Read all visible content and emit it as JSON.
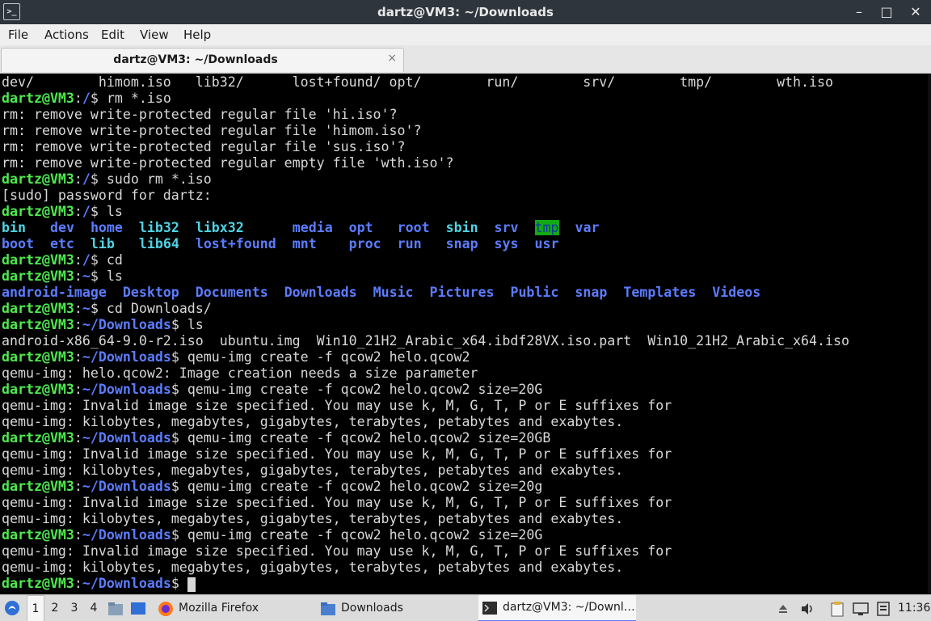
{
  "window": {
    "title": "dartz@VM3: ~/Downloads",
    "icon_text": ">_",
    "controls": {
      "minimize": "–",
      "maximize": "□",
      "close": "✕"
    }
  },
  "menu": [
    "File",
    "Actions",
    "Edit",
    "View",
    "Help"
  ],
  "tab": {
    "label": "dartz@VM3: ~/Downloads",
    "close": "×"
  },
  "colors": {
    "user_host": "#4ee94e",
    "path": "#5c7cff",
    "directory": "#5c7cff",
    "symlink": "#4fd3e3",
    "tmp_highlight": "#14a814",
    "text": "#d8d8d8"
  },
  "terminal": {
    "prompt_user": "dartz@VM3",
    "lines": [
      "dev/        himom.iso   lib32/      lost+found/ opt/        run/        srv/        tmp/        wth.iso",
      "rm *.iso",
      "rm: remove write-protected regular file 'hi.iso'?",
      "rm: remove write-protected regular file 'himom.iso'?",
      "rm: remove write-protected regular file 'sus.iso'?",
      "rm: remove write-protected regular empty file 'wth.iso'?",
      "sudo rm *.iso",
      "[sudo] password for dartz:",
      "ls",
      "cd",
      "ls",
      "cd Downloads/",
      "ls",
      "android-x86_64-9.0-r2.iso  ubuntu.img  Win10_21H2_Arabic_x64.ibdf28VX.iso.part  Win10_21H2_Arabic_x64.iso",
      "qemu-img create -f qcow2 helo.qcow2",
      "qemu-img: helo.qcow2: Image creation needs a size parameter",
      "qemu-img create -f qcow2 helo.qcow2 size=20G",
      "qemu-img: Invalid image size specified. You may use k, M, G, T, P or E suffixes for",
      "qemu-img: kilobytes, megabytes, gigabytes, terabytes, petabytes and exabytes.",
      "qemu-img create -f qcow2 helo.qcow2 size=20GB",
      "qemu-img create -f qcow2 helo.qcow2 size=20g",
      "qemu-img create -f qcow2 helo.qcow2 size=20G"
    ],
    "ls_root_row1": [
      "bin",
      "dev",
      "home",
      "lib32",
      "libx32",
      "media",
      "opt",
      "root",
      "sbin",
      "srv",
      "tmp",
      "var"
    ],
    "ls_root_row2": [
      "boot",
      "etc",
      "lib",
      "lib64",
      "lost+found",
      "mnt",
      "proc",
      "run",
      "snap",
      "sys",
      "usr"
    ],
    "ls_home": [
      "android-image",
      "Desktop",
      "Documents",
      "Downloads",
      "Music",
      "Pictures",
      "Public",
      "snap",
      "Templates",
      "Videos"
    ]
  },
  "taskbar": {
    "workspaces": [
      "1",
      "2",
      "3",
      "4"
    ],
    "tasks": [
      "Mozilla Firefox",
      "Downloads",
      "dartz@VM3: ~/Downl…"
    ],
    "clock": "11:36"
  }
}
